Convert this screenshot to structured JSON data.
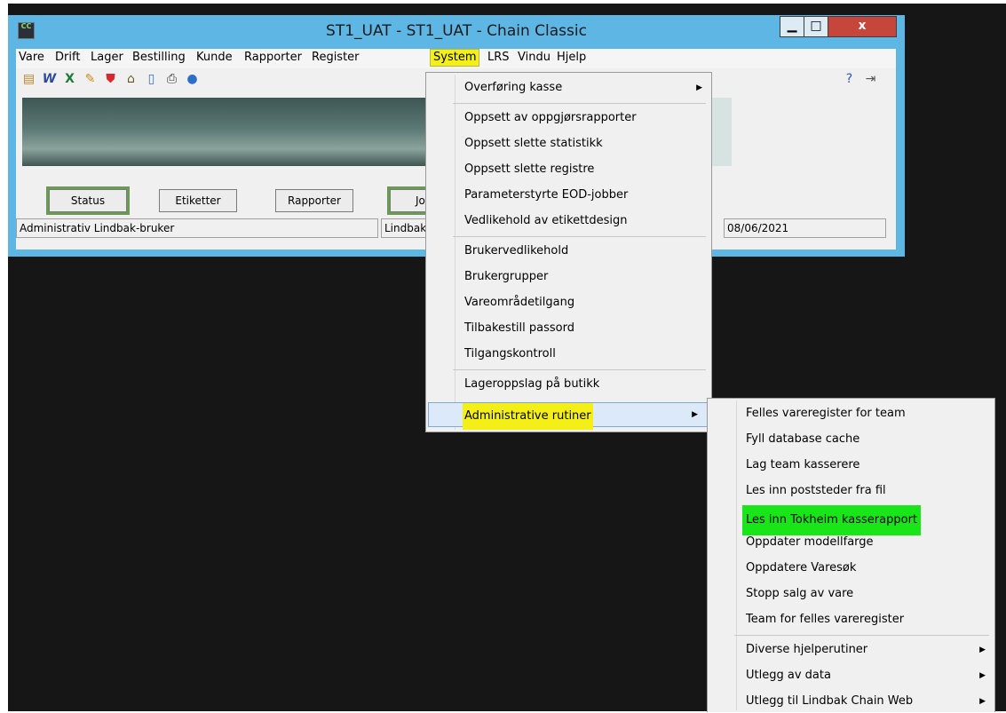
{
  "window": {
    "title": "ST1_UAT  -  ST1_UAT  -  Chain Classic",
    "app_icon_text": "CC",
    "minimize": "▁",
    "maximize": "□",
    "close": "x"
  },
  "menubar": {
    "items": [
      "Vare",
      "Drift",
      "Lager",
      "Bestilling",
      "Kunde",
      "Rapporter",
      "Register",
      "System",
      "LRS",
      "Vindu",
      "Hjelp"
    ],
    "active": "System"
  },
  "toolbar": {
    "icons": [
      "calculator-icon",
      "word-icon",
      "excel-icon",
      "edit-icon",
      "shield-icon",
      "home-icon",
      "document-icon",
      "print-preview-icon",
      "globe-icon"
    ],
    "right_icons": [
      "help-icon",
      "exit-icon"
    ]
  },
  "buttons": {
    "status": "Status",
    "etiketter": "Etiketter",
    "rapporter": "Rapporter",
    "jobber": "Jo"
  },
  "statusbar": {
    "user": "Administrativ Lindbak-bruker",
    "company": "Lindbak",
    "date": "08/06/2021"
  },
  "system_menu": {
    "items": [
      {
        "label": "Overføring kasse",
        "submenu": true
      },
      {
        "label": "Oppsett av oppgjørsrapporter"
      },
      {
        "label": "Oppsett slette statistikk"
      },
      {
        "label": "Oppsett slette registre"
      },
      {
        "label": "Parameterstyrte EOD-jobber"
      },
      {
        "label": "Vedlikehold av etikettdesign"
      },
      {
        "label": "Brukervedlikehold"
      },
      {
        "label": "Brukergrupper"
      },
      {
        "label": "Vareområdetilgang"
      },
      {
        "label": "Tilbakestill passord"
      },
      {
        "label": "Tilgangskontroll"
      },
      {
        "label": "Lageroppslag på butikk"
      },
      {
        "label": "Administrative rutiner",
        "submenu": true,
        "highlighted": true
      }
    ]
  },
  "admin_submenu": {
    "items": [
      {
        "label": "Felles vareregister for team"
      },
      {
        "label": "Fyll database cache"
      },
      {
        "label": "Lag team kasserere"
      },
      {
        "label": "Les inn poststeder fra fil"
      },
      {
        "label": "Les inn Tokheim kasserapport",
        "highlighted": true
      },
      {
        "label": "Oppdater modellfarge"
      },
      {
        "label": "Oppdatere Varesøk"
      },
      {
        "label": "Stopp salg av vare"
      },
      {
        "label": "Team for felles vareregister"
      },
      {
        "label": "Diverse hjelperutiner",
        "submenu": true
      },
      {
        "label": "Utlegg av data",
        "submenu": true
      },
      {
        "label": "Utlegg til Lindbak Chain Web",
        "submenu": true
      }
    ]
  },
  "colors": {
    "title_bar": "#5eb6e4",
    "highlight_yellow": "#f4f017",
    "highlight_green": "#19e619",
    "desktop": "#161616"
  }
}
